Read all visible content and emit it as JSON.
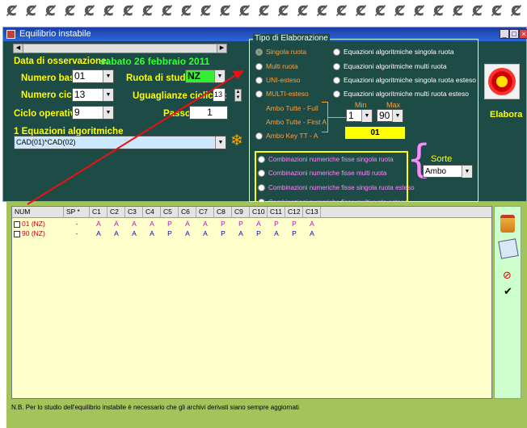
{
  "window": {
    "title": "Equilibrio instabile"
  },
  "date": {
    "label": "Data di osservazione:",
    "value": "sabato 26 febbraio 2011"
  },
  "numero_base": {
    "label": "Numero base:",
    "value": "01"
  },
  "numero_cicli": {
    "label": "Numero cicli:",
    "value": "13"
  },
  "ciclo_operativo": {
    "label": "Ciclo operativo:",
    "value": "9"
  },
  "ruota_studio": {
    "label": "Ruota di studio:",
    "value": "NZ"
  },
  "uguaglianze": {
    "label": "Uguaglianze cicliche:",
    "value": "13"
  },
  "passo": {
    "label": "Passo:",
    "value": "1"
  },
  "equazioni": {
    "label": "1 Equazioni algoritmiche",
    "value": "CAD(01)*CAD(02)"
  },
  "tipo": {
    "legend": "Tipo di Elaborazione",
    "left": [
      "Singola ruota",
      "Multi ruota",
      "UNI-esteso",
      "MULTI-esteso"
    ],
    "right": [
      "Equazioni algoritmiche singola ruota",
      "Equazioni algoritmiche multi ruota",
      "Equazioni algoritmiche singola ruota esteso",
      "Equazioni algoritmiche multi ruota esteso"
    ],
    "ambo": [
      "Ambo Tutte - Full",
      "Ambo Tutte - First A",
      "Ambo Key TT -  A"
    ],
    "min_label": "Min",
    "max_label": "Max",
    "min_value": "1",
    "max_value": "90",
    "key_value": "01",
    "combinazioni": [
      "Combinazioni numeriche fisse singola ruota",
      "Combinazioni numeriche fisse multi ruota",
      "Combinazioni numeriche fisse singola ruota esteso",
      "Combinazioni numeriche fisse multi ruota esteso"
    ],
    "sorte_label": "Sorte",
    "sorte_value": "Ambo"
  },
  "elabora": {
    "label": "Elabora"
  },
  "grid": {
    "headers": [
      "NUM",
      "SP *",
      "C1",
      "C2",
      "C3",
      "C4",
      "C5",
      "C6",
      "C7",
      "C8",
      "C9",
      "C10",
      "C11",
      "C12",
      "C13"
    ],
    "rows": [
      {
        "num": "01  (NZ)",
        "sp": "-",
        "cells": [
          "A",
          "A",
          "A",
          "A",
          "P",
          "A",
          "A",
          "P",
          "P",
          "A",
          "P",
          "P",
          "A"
        ],
        "color": "#cc00cc"
      },
      {
        "num": "90  (NZ)",
        "sp": "-",
        "cells": [
          "A",
          "A",
          "A",
          "A",
          "P",
          "A",
          "A",
          "P",
          "A",
          "P",
          "A",
          "P",
          "A"
        ],
        "color": "#0000cc"
      }
    ]
  },
  "note": "N.B. Per lo studio dell'equilibrio instabile è necessario che gli archivi derivati siano sempre aggiornati",
  "colors": {
    "panel_bg": "#1d4b45",
    "label_yellow": "#ffff00",
    "grid_bg": "#ffffcc",
    "outer_bg": "#a3c45a"
  }
}
